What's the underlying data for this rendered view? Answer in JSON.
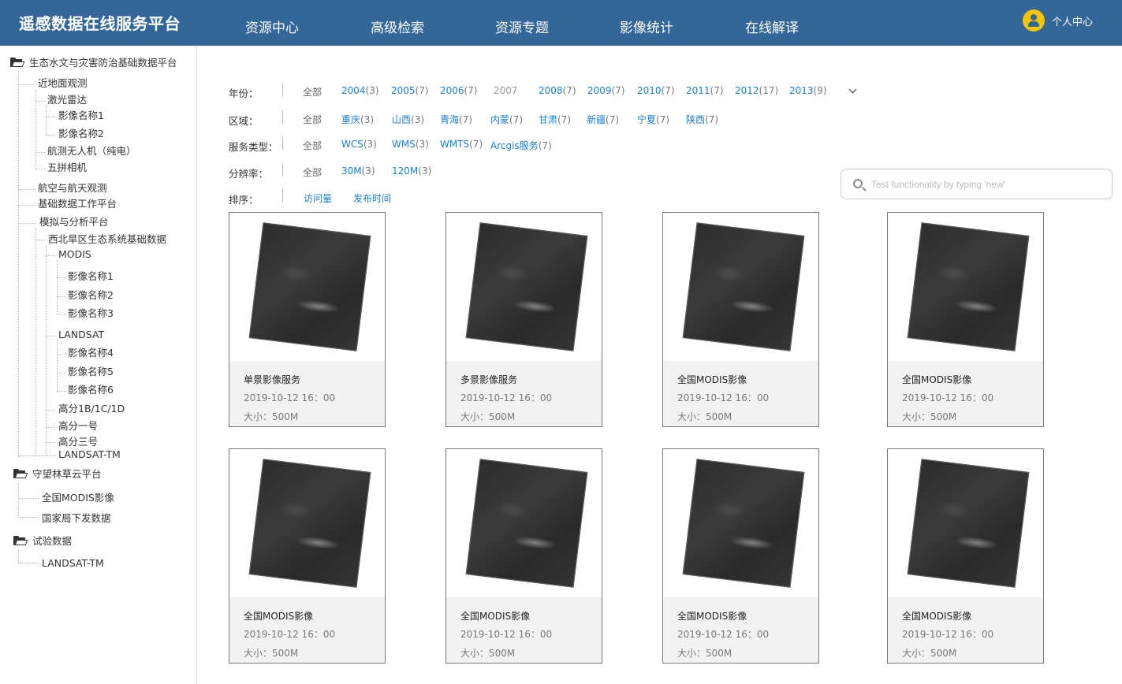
{
  "header": {
    "brand": "遥感数据在线服务平台",
    "nav": [
      "资源中心",
      "高级检索",
      "资源专题",
      "影像统计",
      "在线解译"
    ],
    "user_label": "个人中心"
  },
  "sidebar": {
    "tree": [
      "生态水文与灾害防治基础数据平台",
      "近地面观测",
      "激光雷达",
      "影像名称1",
      "影像名称2",
      "航测无人机（纯电）",
      "五拼相机",
      "航空与航天观测",
      "基础数据工作平台",
      "模拟与分析平台",
      "西北旱区生态系统基础数据",
      "MODIS",
      "影像名称1",
      "影像名称2",
      "影像名称3",
      "LANDSAT",
      "影像名称4",
      "影像名称5",
      "影像名称6",
      "高分1B/1C/1D",
      "高分一号",
      "高分三号",
      "LANDSAT-TM",
      "守望林草云平台",
      "全国MODIS影像",
      "国家局下发数据",
      "试验数据",
      "LANDSAT-TM"
    ]
  },
  "filters": {
    "year": {
      "label": "年份：",
      "all": "全部",
      "options": [
        {
          "name": "2004",
          "count": "(3)"
        },
        {
          "name": "2005",
          "count": "(7)"
        },
        {
          "name": "2006",
          "count": "(7)"
        },
        {
          "name": "2007",
          "count": ""
        },
        {
          "name": "2008",
          "count": "(7)"
        },
        {
          "name": "2009",
          "count": "(7)"
        },
        {
          "name": "2010",
          "count": "(7)"
        },
        {
          "name": "2011",
          "count": "(7)"
        },
        {
          "name": "2012",
          "count": "(17)"
        },
        {
          "name": "2013",
          "count": "(9)"
        }
      ]
    },
    "region": {
      "label": "区域：",
      "all": "全部",
      "options": [
        {
          "name": "重庆",
          "count": "(3)"
        },
        {
          "name": "山西",
          "count": "(3)"
        },
        {
          "name": "青海",
          "count": "(7)"
        },
        {
          "name": "内蒙",
          "count": "(7)"
        },
        {
          "name": "甘肃",
          "count": "(7)"
        },
        {
          "name": "新疆",
          "count": "(7)"
        },
        {
          "name": "宁夏",
          "count": "(7)"
        },
        {
          "name": "陕西",
          "count": "(7)"
        }
      ]
    },
    "service_type": {
      "label": "服务类型：",
      "all": "全部",
      "options": [
        {
          "name": "WCS",
          "count": "(3)"
        },
        {
          "name": "WMS",
          "count": "(3)"
        },
        {
          "name": "WMTS",
          "count": "(7)"
        },
        {
          "name": "Arcgis服务",
          "count": "(7)"
        }
      ]
    },
    "resolution": {
      "label": "分辨率：",
      "all": "全部",
      "options": [
        {
          "name": "30M",
          "count": "(3)"
        },
        {
          "name": "120M",
          "count": "(3)"
        }
      ]
    },
    "sort": {
      "label": "排序：",
      "options": [
        "访问量",
        "发布时间"
      ]
    }
  },
  "search": {
    "placeholder": "Test functionality by typing 'new'",
    "icon": "search-icon"
  },
  "cards": [
    {
      "title": "单景影像服务",
      "date": "2019-10-12 16：00",
      "size": "大小：500M"
    },
    {
      "title": "多景影像服务",
      "date": "2019-10-12 16：00",
      "size": "大小：500M"
    },
    {
      "title": "全国MODIS影像",
      "date": "2019-10-12 16：00",
      "size": "大小：500M"
    },
    {
      "title": "全国MODIS影像",
      "date": "2019-10-12 16：00",
      "size": "大小：500M"
    },
    {
      "title": "全国MODIS影像",
      "date": "2019-10-12 16：00",
      "size": "大小：500M"
    },
    {
      "title": "全国MODIS影像",
      "date": "2019-10-12 16：00",
      "size": "大小：500M"
    },
    {
      "title": "全国MODIS影像",
      "date": "2019-10-12 16：00",
      "size": "大小：500M"
    },
    {
      "title": "全国MODIS影像",
      "date": "2019-10-12 16：00",
      "size": "大小：500M"
    }
  ],
  "colors": {
    "header_bg": "#336699",
    "link": "#1a7fd4",
    "avatar": "#f5c400"
  }
}
